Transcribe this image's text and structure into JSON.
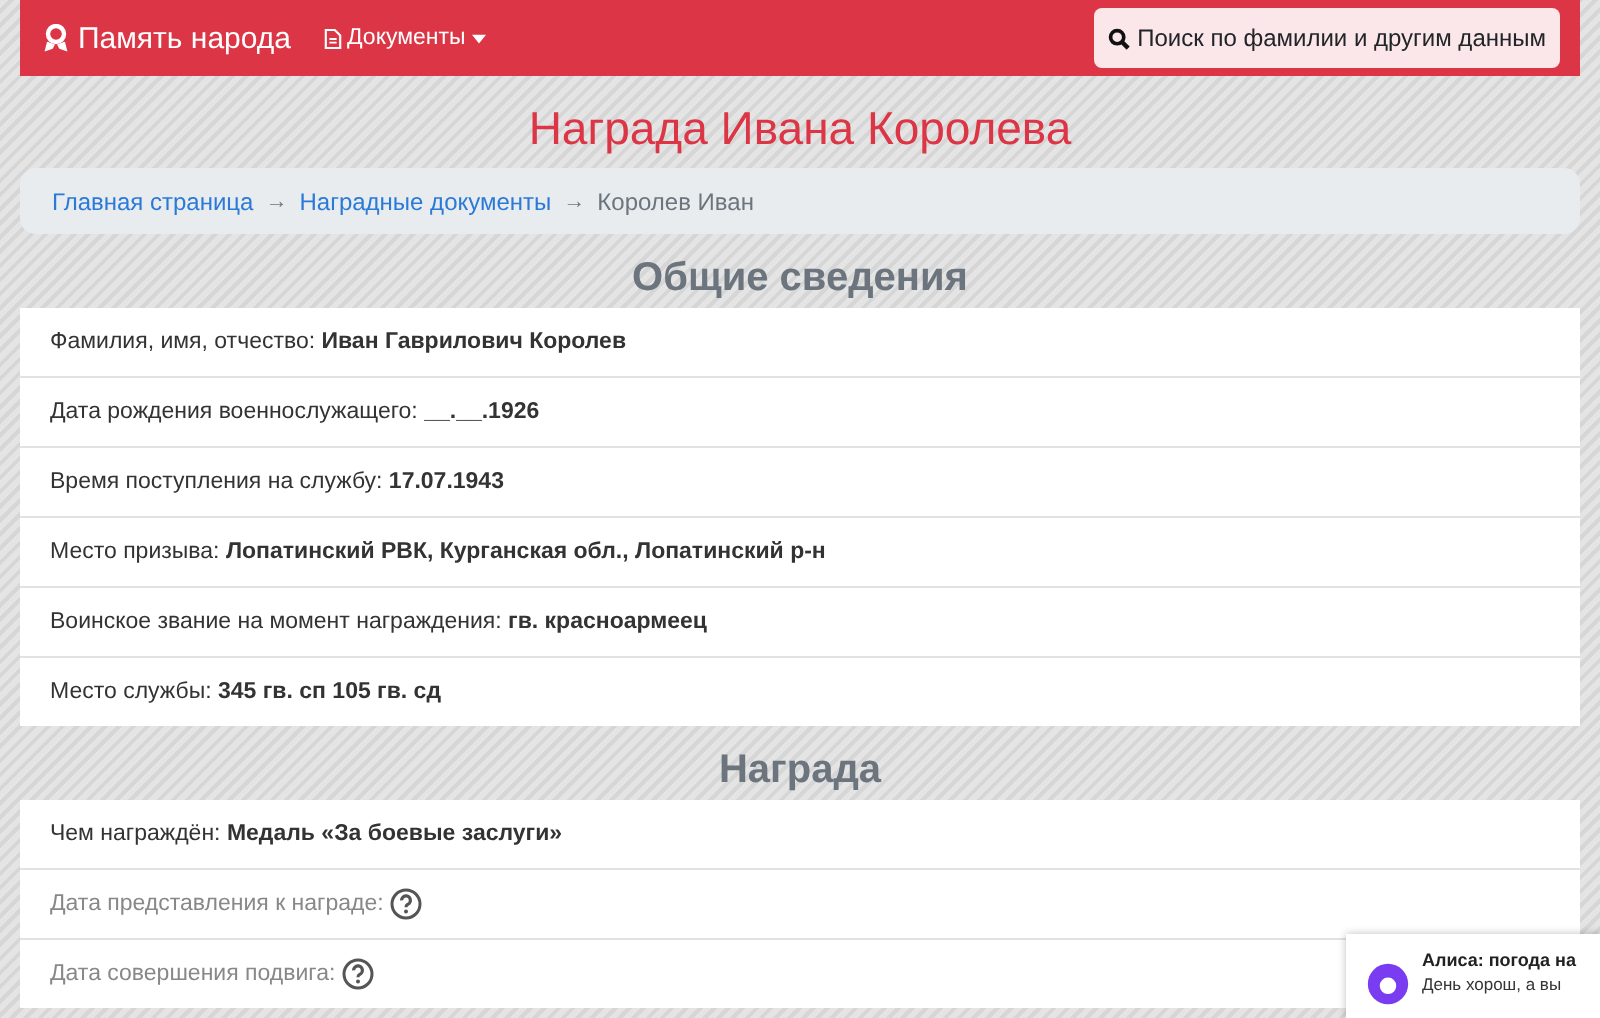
{
  "navbar": {
    "brand": "Память народа",
    "menu": [
      {
        "label": "Документы",
        "dropdown": true
      }
    ],
    "search_button": "Поиск по фамилии и другим данным"
  },
  "title": "Награда Ивана Королева",
  "breadcrumb": [
    {
      "label": "Главная страница",
      "link": true
    },
    {
      "separator": "→",
      "label": "Наградные документы",
      "link": true
    },
    {
      "separator": "→",
      "label": "Королев Иван",
      "link": false
    }
  ],
  "sections": [
    {
      "heading": "Общие сведения",
      "rows": [
        {
          "kind": "value",
          "label": "Фамилия, имя, отчество:",
          "value": "Иван Гаврилович Королев"
        },
        {
          "kind": "value",
          "label": "Дата рождения военнослужащего:",
          "value": "__.__.1926"
        },
        {
          "kind": "value",
          "label": "Время поступления на службу:",
          "value": "17.07.1943"
        },
        {
          "kind": "value",
          "label": "Место призыва:",
          "value": "Лопатинский РВК, Курганская обл., Лопатинский р-н"
        },
        {
          "kind": "value",
          "label": "Воинское звание на момент награждения:",
          "value": "гв. красноармеец"
        },
        {
          "kind": "value",
          "label": "Место службы:",
          "value": "345 гв. сп 105 гв. сд"
        }
      ]
    },
    {
      "heading": "Награда",
      "rows": [
        {
          "kind": "value",
          "label": "Чем награждён:",
          "value": "Медаль «За боевые заслуги»"
        },
        {
          "kind": "unknown",
          "label": "Дата представления к награде:"
        },
        {
          "kind": "unknown",
          "label": "Дата совершения подвига:"
        }
      ]
    }
  ],
  "notification": {
    "title": "Алиса: погода на",
    "text": "День хорош, а вы"
  }
}
